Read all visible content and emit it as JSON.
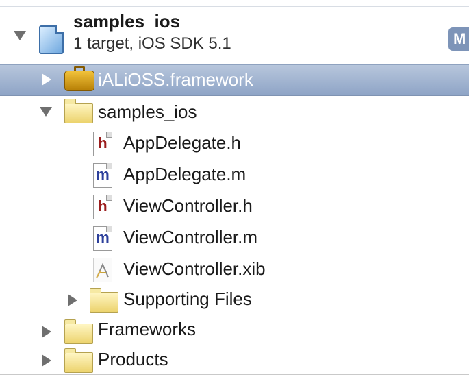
{
  "navigator": {
    "project": {
      "name": "samples_ios",
      "subtitle": "1 target, iOS SDK 5.1",
      "badge": "M"
    },
    "items": [
      {
        "label": "iALiOSS.framework",
        "icon": "framework-toolbox-icon",
        "disclosure": "collapsed",
        "selected": true
      },
      {
        "label": "samples_ios",
        "icon": "folder-icon",
        "disclosure": "expanded"
      },
      {
        "label": "AppDelegate.h",
        "icon": "header-file-icon",
        "glyph": "h"
      },
      {
        "label": "AppDelegate.m",
        "icon": "implementation-file-icon",
        "glyph": "m"
      },
      {
        "label": "ViewController.h",
        "icon": "header-file-icon",
        "glyph": "h"
      },
      {
        "label": "ViewController.m",
        "icon": "implementation-file-icon",
        "glyph": "m"
      },
      {
        "label": "ViewController.xib",
        "icon": "xib-file-icon"
      },
      {
        "label": "Supporting Files",
        "icon": "folder-icon",
        "disclosure": "collapsed"
      },
      {
        "label": "Frameworks",
        "icon": "folder-icon",
        "disclosure": "collapsed"
      },
      {
        "label": "Products",
        "icon": "folder-icon",
        "disclosure": "collapsed"
      }
    ],
    "colors": {
      "selection": "#8ea4c6",
      "header_glyph": "#9b1d1d",
      "implementation_glyph": "#2c3f9b",
      "folder": "#ecd36d"
    }
  }
}
